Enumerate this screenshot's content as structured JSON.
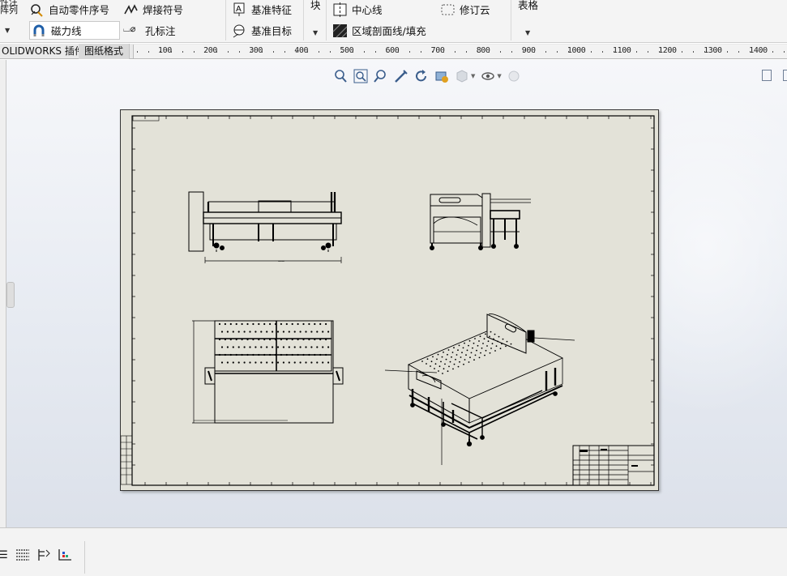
{
  "ribbon": {
    "partial_label_top": "性注",
    "partial_label_bottom": "阵列",
    "auto_balloon": "自动零件序号",
    "weld_symbol": "焊接符号",
    "datum_feature": "基准特征",
    "block": "块",
    "centerline": "中心线",
    "revision_cloud": "修订云",
    "table": "表格",
    "magnetic_line": "磁力线",
    "hole_callout": "孔标注",
    "datum_target": "基准目标",
    "area_hatch": "区域剖面线/填充"
  },
  "tabs": [
    {
      "label": "OLIDWORKS 插件",
      "active": false
    },
    {
      "label": "图纸格式",
      "active": true
    }
  ],
  "ruler": {
    "ticks": [
      "100",
      "200",
      "300",
      "400",
      "500",
      "600",
      "700",
      "800",
      "900",
      "1000",
      "1100",
      "1200",
      "1300",
      "1400"
    ]
  },
  "view_toolbar": {
    "icons": [
      "zoom-fit-icon",
      "zoom-area-icon",
      "zoom-in-out-icon",
      "pan-icon",
      "rotate-icon",
      "view-settings-icon",
      "display-style-icon",
      "hide-show-icon",
      "appearance-icon"
    ]
  },
  "colors": {
    "sheet": "#e3e2d8",
    "ink": "#000000",
    "accent_icon": "#3a5d8c"
  }
}
